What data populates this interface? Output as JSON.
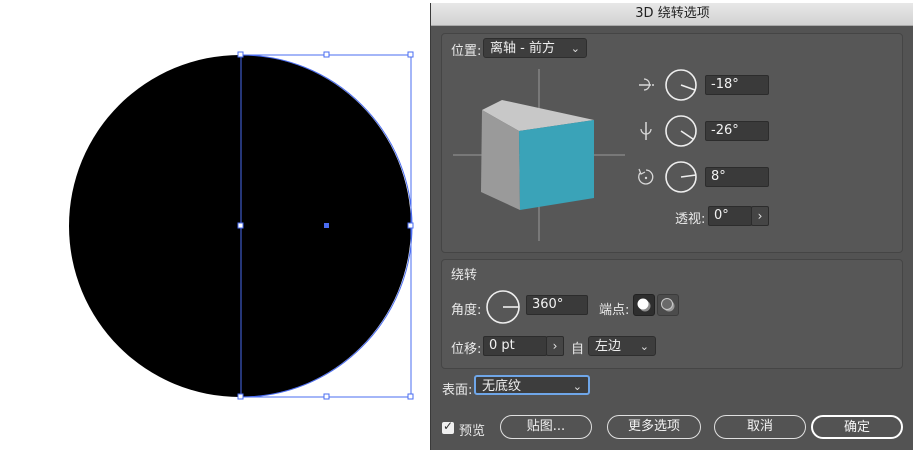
{
  "dialog": {
    "title": "3D 绕转选项"
  },
  "position": {
    "label": "位置:",
    "preset": "离轴 - 前方",
    "x_rotation": "-18°",
    "y_rotation": "-26°",
    "z_rotation": "8°",
    "perspective_label": "透视:",
    "perspective": "0°"
  },
  "revolve": {
    "section_title": "绕转",
    "angle_label": "角度:",
    "angle": "360°",
    "cap_label": "端点:",
    "offset_label": "位移:",
    "offset": "0 pt",
    "from_label": "自",
    "from": "左边"
  },
  "surface": {
    "label": "表面:",
    "value": "无底纹"
  },
  "footer": {
    "preview_label": "预览",
    "preview_checked": true,
    "map_label": "贴图...",
    "more_label": "更多选项",
    "cancel_label": "取消",
    "ok_label": "确定"
  },
  "colors": {
    "cube_front": "#3aa3b8",
    "cube_top": "#c8c8c8",
    "cube_side": "#9a9a9a",
    "selection": "#4a6cf0"
  }
}
